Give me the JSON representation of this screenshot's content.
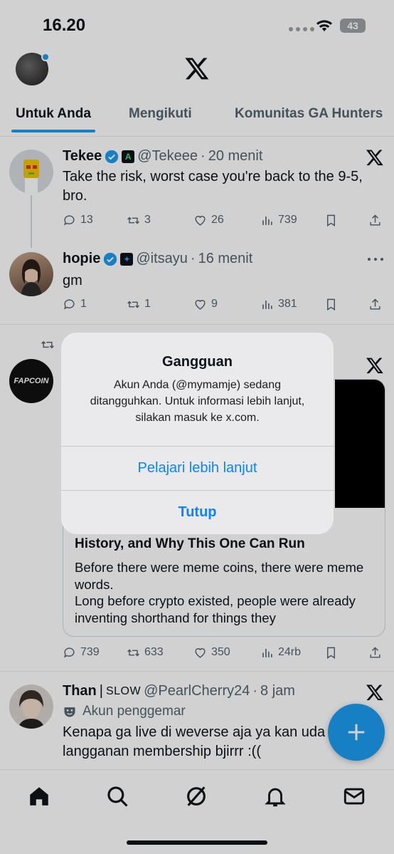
{
  "status": {
    "time": "16.20",
    "battery": "43"
  },
  "tabs": [
    {
      "label": "Untuk Anda"
    },
    {
      "label": "Mengikuti"
    },
    {
      "label": "Komunitas GA Hunters"
    }
  ],
  "posts": [
    {
      "name": "Tekee",
      "handle": "@Tekeee",
      "time": "20 menit",
      "text": "Take the risk, worst case you're back to the 9-5, bro.",
      "badge": "A",
      "replies": "13",
      "reposts": "3",
      "likes": "26",
      "views": "739"
    },
    {
      "name": "hopie",
      "handle": "@itsayu",
      "time": "16 menit",
      "text": "gm",
      "replies": "1",
      "reposts": "1",
      "likes": "9",
      "views": "381"
    },
    {
      "avatar_text": "FAPCOIN",
      "card_title": "History, and Why This One Can Run",
      "card_desc": "Before there were meme coins, there were meme words.\nLong before crypto existed, people were already inventing shorthand for things they",
      "replies": "739",
      "reposts": "633",
      "likes": "350",
      "views": "24rb"
    },
    {
      "name": "Than",
      "name_suffix": "SLOW",
      "handle": "@PearlCherry24",
      "time": "8 jam",
      "fan_label": "Akun penggemar",
      "text": "Kenapa ga live di weverse aja ya kan uda langganan membership bjirrr :(("
    }
  ],
  "dialog": {
    "title": "Gangguan",
    "message": "Akun Anda (@mymamje) sedang ditangguhkan. Untuk informasi lebih lanjut, silakan masuk ke x.com.",
    "learn_more": "Pelajari lebih lanjut",
    "close": "Tutup"
  },
  "nav": [
    "home-icon",
    "search-icon",
    "grok-icon",
    "notifications-icon",
    "messages-icon"
  ],
  "colors": {
    "accent": "#1d9bf0",
    "text": "#0f1419",
    "muted": "#536471",
    "dialog_button": "#0a84ff"
  }
}
